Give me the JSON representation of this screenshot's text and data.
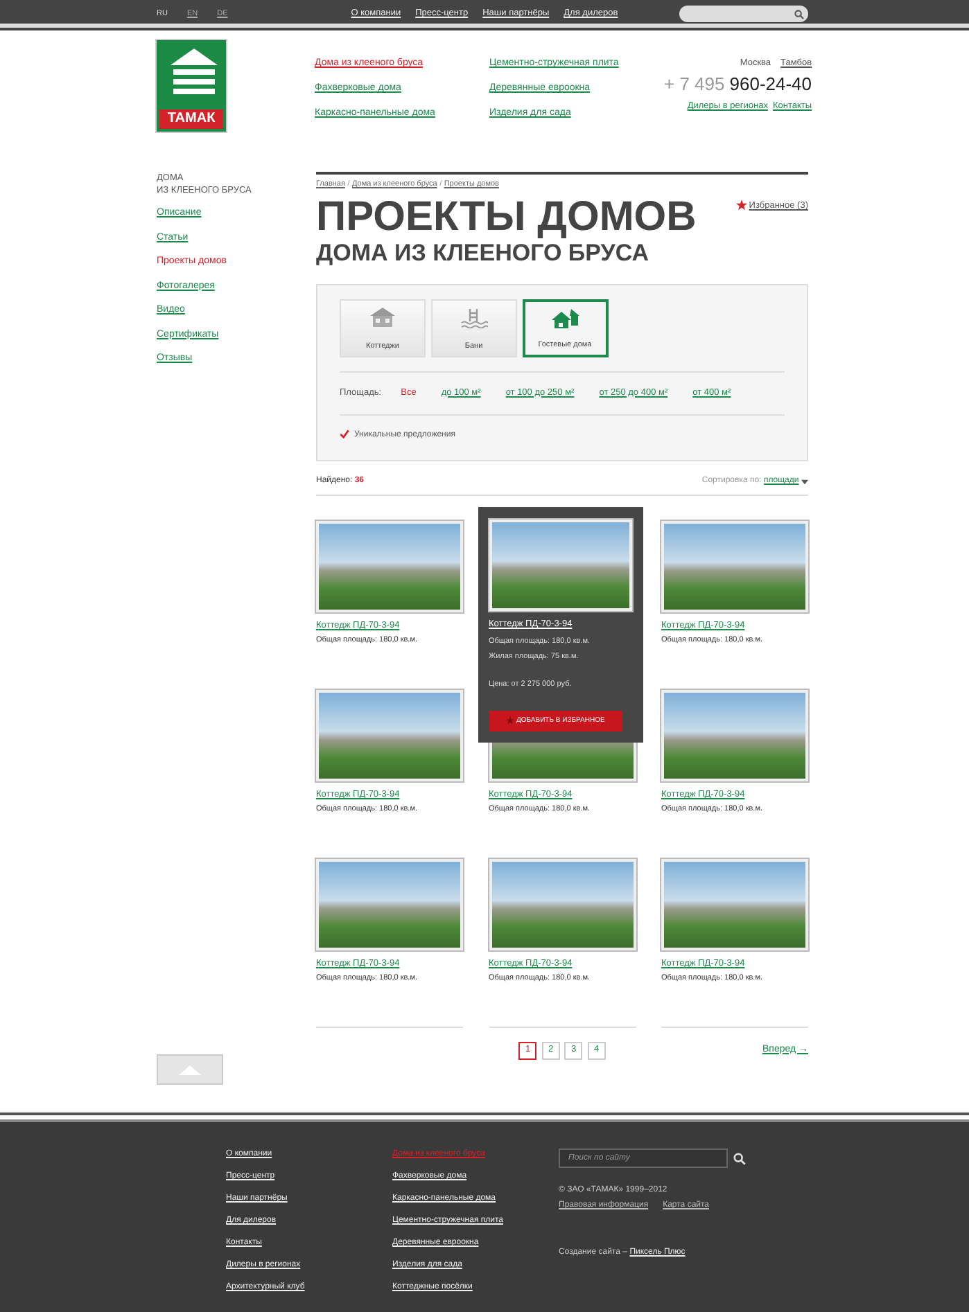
{
  "top_bar": {
    "languages": [
      {
        "label": "RU",
        "selected": true
      },
      {
        "label": "EN",
        "selected": false
      },
      {
        "label": "DE",
        "selected": false
      }
    ],
    "nav": [
      "О компании",
      "Пресс-центр",
      "Наши партнёры",
      "Для дилеров"
    ]
  },
  "logo": {
    "text": "ТАМАК"
  },
  "header": {
    "menu": [
      {
        "label": "Дома из клееного бруса",
        "selected": true
      },
      {
        "label": "Фахверковые дома",
        "selected": false
      },
      {
        "label": "Каркасно-панельные дома",
        "selected": false
      },
      {
        "label": "Цементно-стружечная плита",
        "selected": false
      },
      {
        "label": "Деревянные евроокна",
        "selected": false
      },
      {
        "label": "Изделия для сада",
        "selected": false
      }
    ],
    "cities": [
      {
        "label": "Москва",
        "selected": true
      },
      {
        "label": "Тамбов",
        "selected": false
      }
    ],
    "phone_code": "+ 7 495",
    "phone_number": "960-24-40",
    "links": [
      "Дилеры в регионах",
      "Контакты"
    ]
  },
  "sidebar": {
    "title_lines": [
      "ДОМА",
      "ИЗ КЛЕЕНОГО БРУСА"
    ],
    "items": [
      {
        "label": "Описание",
        "selected": false
      },
      {
        "label": "Статьи",
        "selected": false
      },
      {
        "label": "Проекты домов",
        "selected": true
      },
      {
        "label": "Фотогалерея",
        "selected": false
      },
      {
        "label": "Видео",
        "selected": false
      },
      {
        "label": "Сертификаты",
        "selected": false
      },
      {
        "label": "Отзывы",
        "selected": false
      }
    ]
  },
  "breadcrumbs": [
    "Главная",
    "Дома из клееного бруса",
    "Проекты домов"
  ],
  "breadcrumb_separator": "/",
  "heading": "ПРОЕКТЫ ДОМОВ",
  "subheading": "ДОМА ИЗ КЛЕЕНОГО БРУСА",
  "favorites": "Избранное (3)",
  "filter": {
    "categories": [
      {
        "label": "Коттеджи",
        "kind": "cottage",
        "selected": false
      },
      {
        "label": "Бани",
        "kind": "bath",
        "selected": false
      },
      {
        "label": "Гостевые дома",
        "kind": "guest",
        "selected": true
      }
    ],
    "area_label": "Площадь:",
    "area_options": [
      {
        "label": "Все",
        "selected": true
      },
      {
        "label": "до 100 м²",
        "selected": false
      },
      {
        "label": "от 100 до 250 м²",
        "selected": false
      },
      {
        "label": "от 250 до 400 м²",
        "selected": false
      },
      {
        "label": "от 400 м²",
        "selected": false
      }
    ],
    "unique": {
      "label": "Уникальные предложения",
      "checked": true
    }
  },
  "results": {
    "found_label": "Найдено:",
    "found_count": "36",
    "sort_label": "Сортировка по:",
    "sort_value": "площади"
  },
  "products": [
    {
      "title": "Коттедж ПД-70-3-94",
      "area": "Общая площадь: 180,0 кв.м.",
      "hovered": false
    },
    {
      "title": "Коттедж ПД-70-3-94",
      "area": "Общая площадь: 180,0 кв.м.",
      "hovered": true,
      "living_area": "Жилая площадь: 75 кв.м.",
      "price": "Цена: от 2 275 000 руб.",
      "button": "ДОБАВИТЬ В ИЗБРАННОЕ"
    },
    {
      "title": "Коттедж ПД-70-3-94",
      "area": "Общая площадь: 180,0 кв.м.",
      "hovered": false
    },
    {
      "title": "Коттедж ПД-70-3-94",
      "area": "Общая площадь: 180,0 кв.м.",
      "hovered": false
    },
    {
      "title": "Коттедж ПД-70-3-94",
      "area": "Общая площадь: 180,0 кв.м.",
      "hovered": false
    },
    {
      "title": "Коттедж ПД-70-3-94",
      "area": "Общая площадь: 180,0 кв.м.",
      "hovered": false
    },
    {
      "title": "Коттедж ПД-70-3-94",
      "area": "Общая площадь: 180,0 кв.м.",
      "hovered": false
    },
    {
      "title": "Коттедж ПД-70-3-94",
      "area": "Общая площадь: 180,0 кв.м.",
      "hovered": false
    },
    {
      "title": "Коттедж ПД-70-3-94",
      "area": "Общая площадь: 180,0 кв.м.",
      "hovered": false
    }
  ],
  "pagination": {
    "pages": [
      {
        "label": "1",
        "selected": true
      },
      {
        "label": "2",
        "selected": false
      },
      {
        "label": "3",
        "selected": false
      },
      {
        "label": "4",
        "selected": false
      }
    ],
    "next": "Вперед →"
  },
  "footer": {
    "company_links": [
      "О компании",
      "Пресс-центр",
      "Наши партнёры",
      "Для дилеров",
      "Контакты",
      "Дилеры в регионах",
      "Архитектурный клуб"
    ],
    "product_links": [
      {
        "label": "Дома из клееного бруса",
        "selected": true
      },
      {
        "label": "Фахверковые дома",
        "selected": false
      },
      {
        "label": "Каркасно-панельные дома",
        "selected": false
      },
      {
        "label": "Цементно-стружечная плита",
        "selected": false
      },
      {
        "label": "Деревянные евроокна",
        "selected": false
      },
      {
        "label": "Изделия для сада",
        "selected": false
      },
      {
        "label": "Коттеджные посёлки",
        "selected": false
      }
    ],
    "search_placeholder": "Поиск по сайту",
    "copyright": "© ЗАО «ТАМАК» 1999–2012",
    "links": [
      "Правовая информация",
      "Карта сайта"
    ],
    "credit_text": "Создание сайта –",
    "credit_link": "Пиксель Плюс"
  }
}
